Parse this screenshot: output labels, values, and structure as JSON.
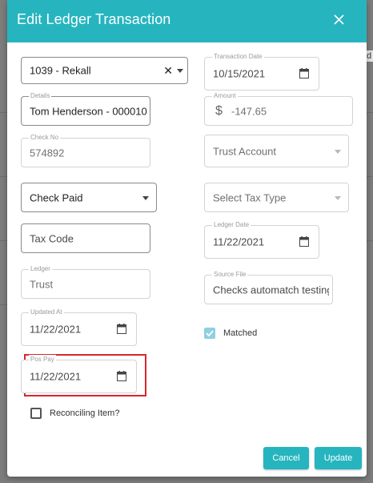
{
  "modal": {
    "title": "Edit Ledger Transaction"
  },
  "backdrop": {
    "right_fragment": "d"
  },
  "fields": {
    "account": {
      "value": "1039 - Rekall",
      "clear_glyph": "✕"
    },
    "transaction_date": {
      "label": "Transaction Date",
      "value": "10/15/2021"
    },
    "details": {
      "label": "Details",
      "value": "Tom Henderson - 000010"
    },
    "amount": {
      "label": "Amount",
      "currency": "$",
      "value": "-147.65"
    },
    "check_no": {
      "label": "Check No",
      "value": "574892"
    },
    "trust_account": {
      "placeholder": "Trust Account"
    },
    "transaction_type": {
      "value": "Check Paid"
    },
    "tax_type": {
      "placeholder": "Select Tax Type"
    },
    "tax_code": {
      "placeholder": "Tax Code"
    },
    "ledger_date": {
      "label": "Ledger Date",
      "value": "11/22/2021"
    },
    "ledger": {
      "label": "Ledger",
      "value": "Trust"
    },
    "source_file": {
      "label": "Source File",
      "value": "Checks automatch testing"
    },
    "updated_at": {
      "label": "Updated At",
      "value": "11/22/2021"
    },
    "matched": {
      "label": "Matched",
      "checked": true
    },
    "pos_pay": {
      "label": "Pos Pay",
      "value": "11/22/2021"
    },
    "reconciling_item": {
      "label": "Reconciling Item?",
      "checked": false
    }
  },
  "buttons": {
    "cancel": "Cancel",
    "update": "Update"
  },
  "colors": {
    "header": "#26b5bf",
    "button": "#26b5bf",
    "highlight": "#d9262b",
    "checkbox_checked": "#8fd0e2"
  }
}
